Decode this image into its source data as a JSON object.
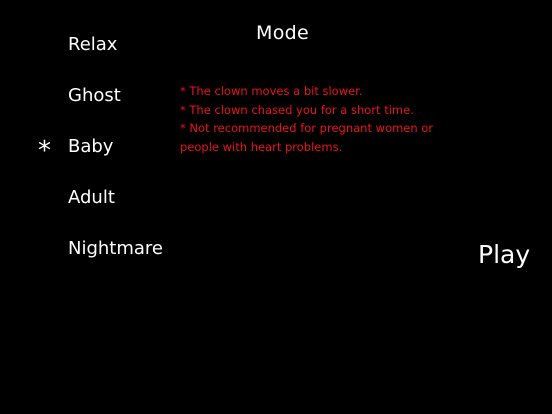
{
  "title": "Mode",
  "modes": [
    {
      "label": "Relax"
    },
    {
      "label": "Ghost"
    },
    {
      "label": "Baby"
    },
    {
      "label": "Adult"
    },
    {
      "label": "Nightmare"
    }
  ],
  "selected_marker": "*",
  "description_lines": [
    "* The clown moves a bit slower.",
    "* The clown chased you for a short time.",
    "* Not recommended for pregnant women or people with heart problems."
  ],
  "play_label": "Play",
  "colors": {
    "background": "#000000",
    "text": "#ffffff",
    "description": "#e8141c"
  }
}
